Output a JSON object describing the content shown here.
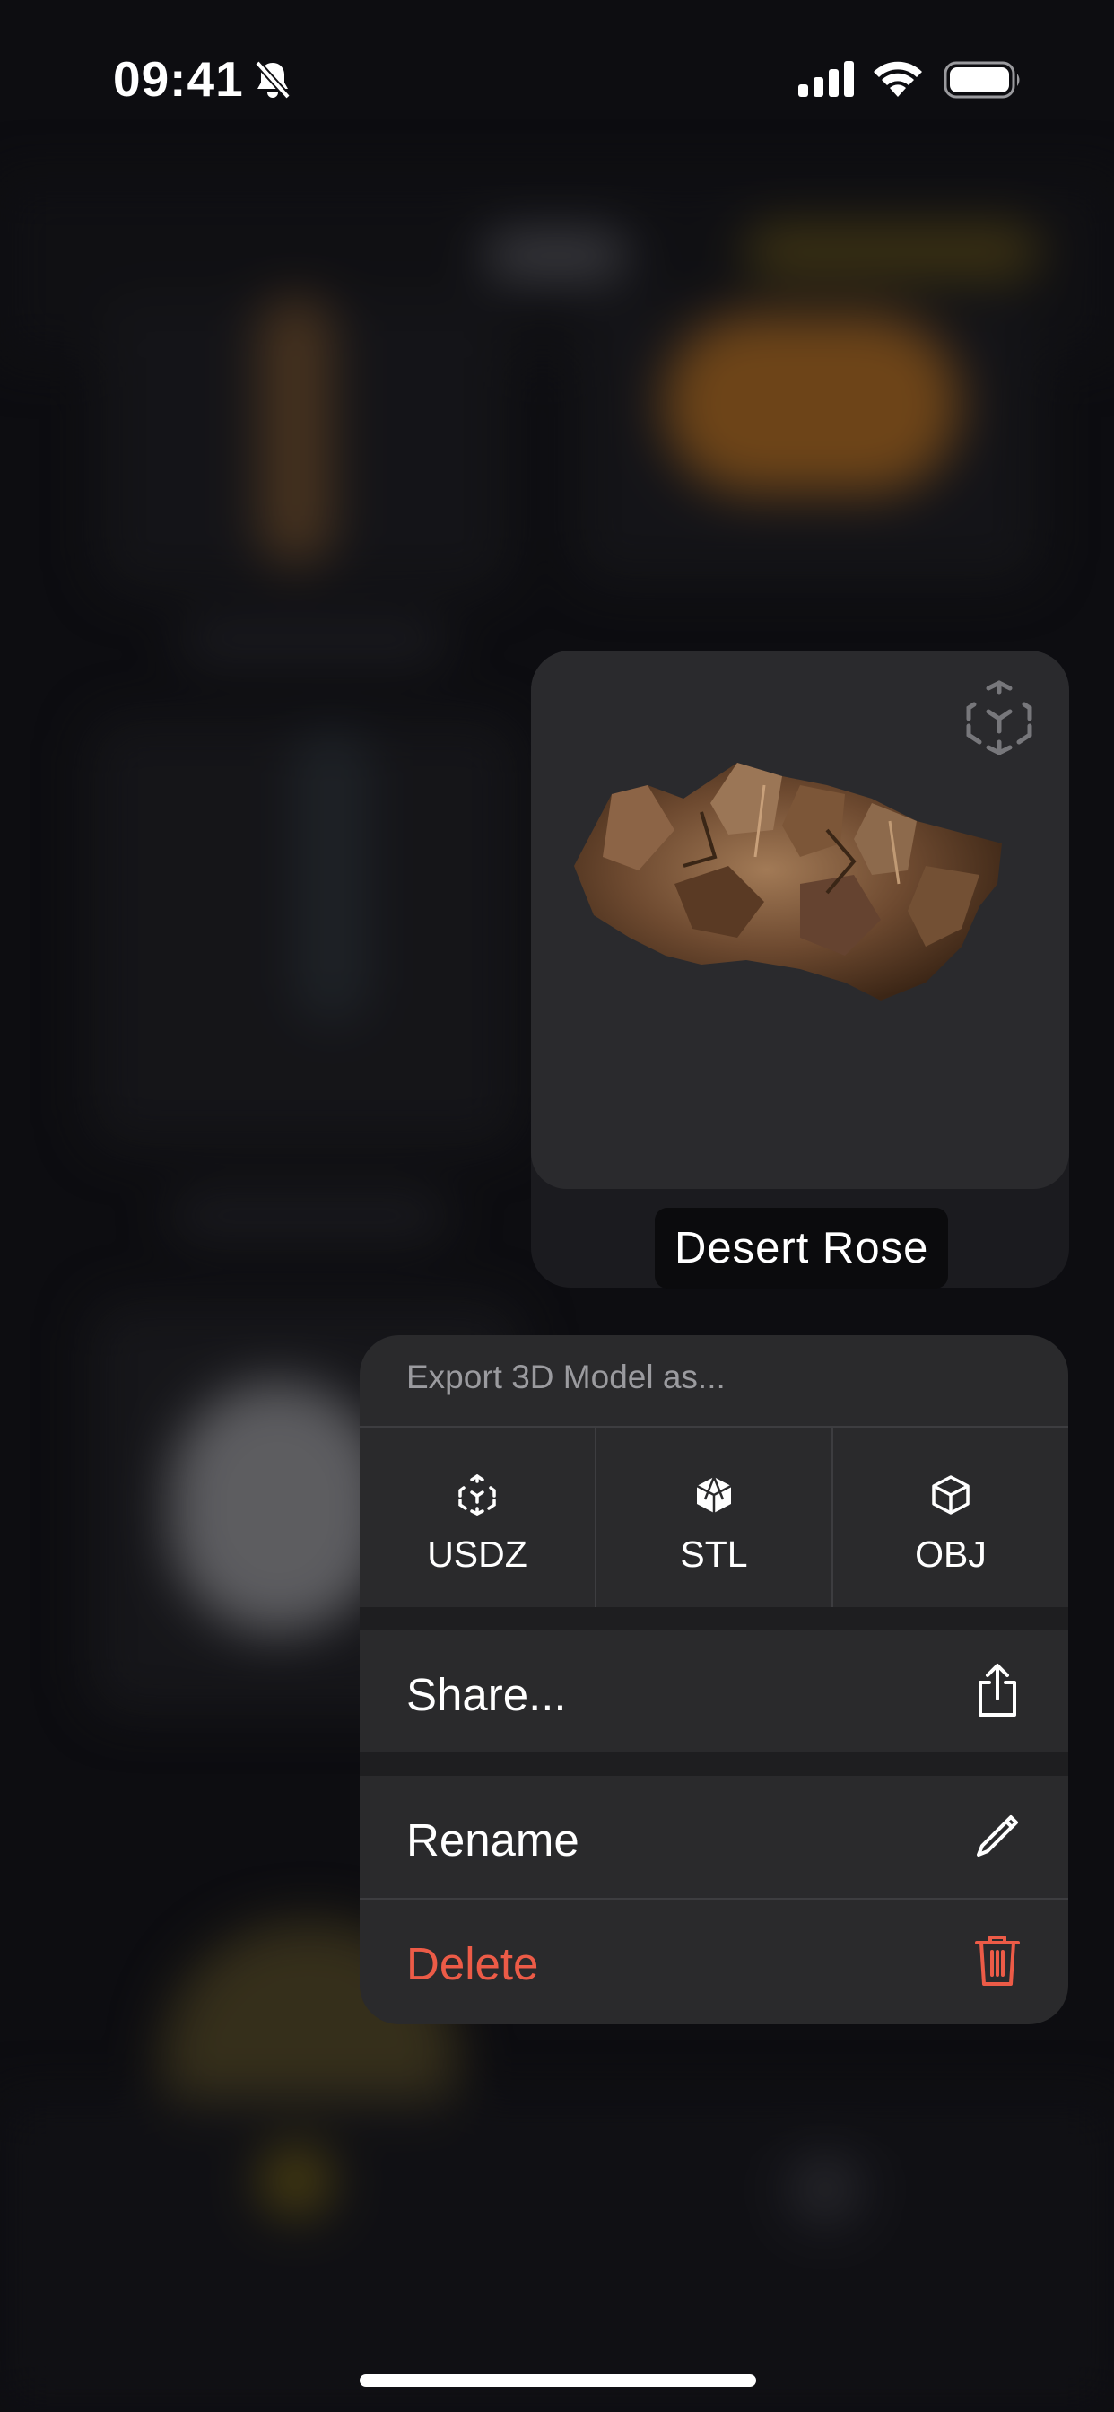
{
  "status_bar": {
    "time": "09:41",
    "icons": [
      "bell-slash-icon",
      "cellular-signal-icon",
      "wifi-icon",
      "battery-icon"
    ]
  },
  "preview": {
    "title": "Desert Rose",
    "badge_icon": "ar-cube-icon"
  },
  "menu": {
    "header": "Export 3D Model as...",
    "export_options": [
      {
        "label": "USDZ",
        "icon": "ar-cube-icon"
      },
      {
        "label": "STL",
        "icon": "solid-cube-icon"
      },
      {
        "label": "OBJ",
        "icon": "wireframe-cube-icon"
      }
    ],
    "share": {
      "label": "Share...",
      "icon": "share-icon"
    },
    "rename": {
      "label": "Rename",
      "icon": "pencil-icon"
    },
    "delete": {
      "label": "Delete",
      "icon": "trash-icon"
    }
  },
  "colors": {
    "destructive": "#ec5b47",
    "menu_background": "#2a2a2c",
    "secondary_text": "#9b9b9f"
  }
}
